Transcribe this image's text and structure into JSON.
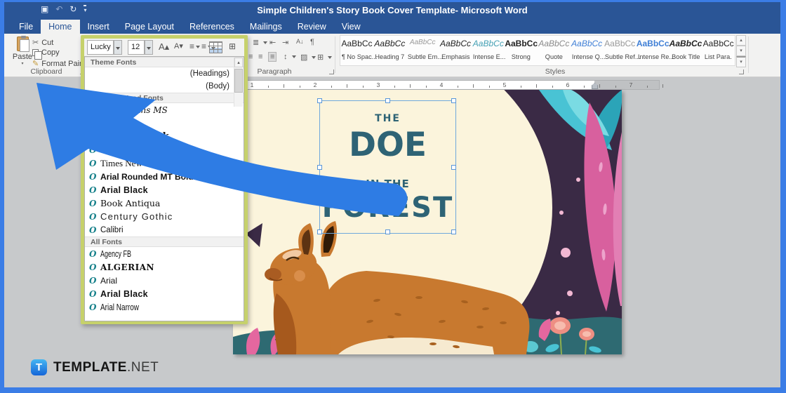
{
  "window": {
    "title": "Simple Children's Story Book Cover Template- Microsoft Word"
  },
  "menu": {
    "tabs": [
      {
        "label": "File",
        "active": false
      },
      {
        "label": "Home",
        "active": true
      },
      {
        "label": "Insert",
        "active": false
      },
      {
        "label": "Page Layout",
        "active": false
      },
      {
        "label": "References",
        "active": false
      },
      {
        "label": "Mailings",
        "active": false
      },
      {
        "label": "Review",
        "active": false
      },
      {
        "label": "View",
        "active": false
      }
    ]
  },
  "ribbon": {
    "clipboard": {
      "label": "Clipboard",
      "paste": "Paste",
      "cut": "Cut",
      "copy": "Copy",
      "format_painter": "Format Painter"
    },
    "font": {
      "name": "Lucky",
      "size": "12"
    },
    "paragraph": {
      "label": "Paragraph"
    },
    "styles": {
      "label": "Styles",
      "preview": "AaBbCc",
      "items": [
        {
          "label": "¶ No Spac...",
          "cls": "sv-plain"
        },
        {
          "label": "Heading 7",
          "cls": "sv-italic"
        },
        {
          "label": "Subtle Em...",
          "cls": "sv-subtle"
        },
        {
          "label": "Emphasis",
          "cls": "sv-italic"
        },
        {
          "label": "Intense E...",
          "cls": "sv-teal"
        },
        {
          "label": "Strong",
          "cls": "sv-bold"
        },
        {
          "label": "Quote",
          "cls": "sv-grayitalic"
        },
        {
          "label": "Intense Q...",
          "cls": "sv-blueitalic"
        },
        {
          "label": "Subtle Ref...",
          "cls": "sv-gray"
        },
        {
          "label": "Intense Re...",
          "cls": "sv-bluebold"
        },
        {
          "label": "Book Title",
          "cls": "sv-bolditalic"
        },
        {
          "label": "List Para.",
          "cls": "sv-plain"
        }
      ]
    }
  },
  "font_dropdown": {
    "sections": [
      {
        "header": "Theme Fonts",
        "rows": [
          {
            "name": "",
            "tag": "(Headings)",
            "cls": "f-sans"
          },
          {
            "name": "",
            "tag": "(Body)",
            "cls": "f-sans"
          }
        ]
      },
      {
        "header": "Recently Used Fonts",
        "rows": [
          {
            "name": "Comic Sans MS",
            "cls": "f-comic"
          },
          {
            "name": "",
            "cls": "f-sans"
          },
          {
            "name": "Cooper Black",
            "cls": "f-cooper"
          },
          {
            "name": "",
            "cls": "f-sans"
          },
          {
            "name": "Times New Roman",
            "cls": "f-serif"
          },
          {
            "name": "Arial Rounded MT Bold",
            "cls": "f-rounded"
          },
          {
            "name": "Arial Black",
            "cls": "f-black"
          },
          {
            "name": "Book Antiqua",
            "cls": "f-antiqua"
          },
          {
            "name": "Century Gothic",
            "cls": "f-gothic"
          },
          {
            "name": "Calibri",
            "cls": "f-calibri"
          }
        ]
      },
      {
        "header": "All Fonts",
        "rows": [
          {
            "name": "Agency FB",
            "cls": "f-agency"
          },
          {
            "name": "ALGERIAN",
            "cls": "f-algerian"
          },
          {
            "name": "Arial",
            "cls": "f-sans"
          },
          {
            "name": "Arial Black",
            "cls": "f-black"
          },
          {
            "name": "Arial Narrow",
            "cls": "f-narrow"
          }
        ]
      }
    ]
  },
  "document": {
    "ruler_numbers": [
      "1",
      "2",
      "3",
      "4",
      "5",
      "6",
      "7"
    ],
    "cover_title": {
      "line1": "The",
      "line2": "Doe",
      "line3": "in The",
      "line4": "Forest"
    }
  },
  "brand": {
    "t": "T",
    "name": "TEMPLATE",
    "suffix": ".NET"
  },
  "icons": {
    "save": "▣",
    "undo": "↶",
    "redo": "↻",
    "cut": "✂",
    "format_painter": "✎",
    "grow_font": "A▴",
    "shrink_font": "A▾",
    "bullets": "≡",
    "numbering": "≡",
    "multilevel": "≣",
    "indent_decrease": "⇤",
    "indent_increase": "⇥",
    "sort": "A↓",
    "pilcrow": "¶",
    "align": "≡",
    "line_spacing": "↕",
    "shading": "▨",
    "borders": "⊞",
    "scroll_up": "▴",
    "scroll_down": "▾",
    "opentype": "O"
  },
  "colors": {
    "accent_blue": "#2e7ce4",
    "title_teal": "#2e6375",
    "highlight_green": "#c6d16b",
    "titlebar_blue": "#2a5596"
  }
}
